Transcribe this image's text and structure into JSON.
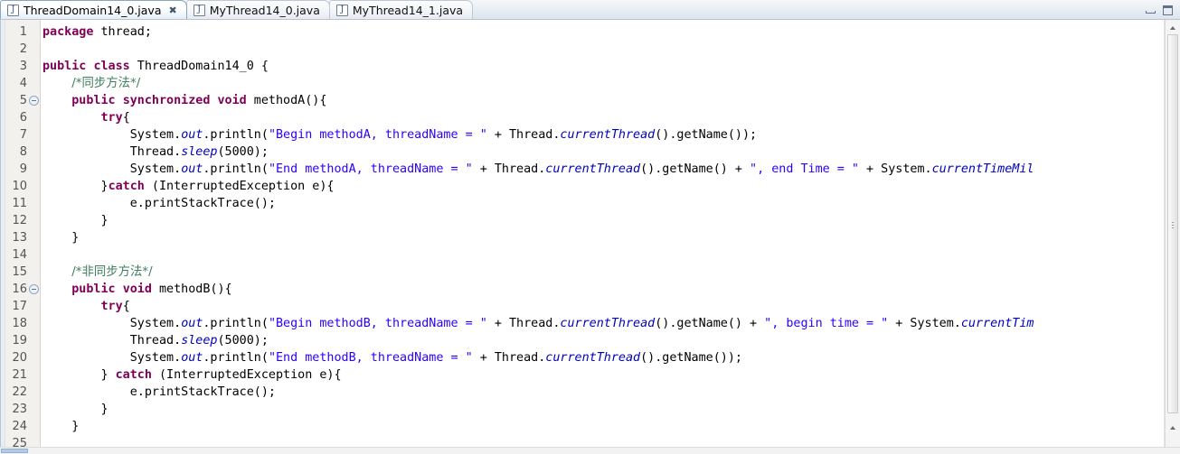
{
  "window": {
    "minimize_label": "Minimize",
    "maximize_label": "Maximize"
  },
  "tabs": [
    {
      "label": "ThreadDomain14_0.java",
      "icon": "java-file-icon",
      "icon_glyph": "J",
      "active": true,
      "close_glyph": "✖"
    },
    {
      "label": "MyThread14_0.java",
      "icon": "java-file-icon",
      "icon_glyph": "J",
      "active": false,
      "close_glyph": ""
    },
    {
      "label": "MyThread14_1.java",
      "icon": "java-file-icon",
      "icon_glyph": "J",
      "active": false,
      "close_glyph": ""
    }
  ],
  "editor": {
    "language": "java",
    "first_visible_line": 1,
    "last_visible_line": 25,
    "fold_marker_lines": [
      5,
      16
    ],
    "fold_glyph": "⊖",
    "line_numbers": [
      1,
      2,
      3,
      4,
      5,
      6,
      7,
      8,
      9,
      10,
      11,
      12,
      13,
      14,
      15,
      16,
      17,
      18,
      19,
      20,
      21,
      22,
      23,
      24,
      25
    ],
    "colors": {
      "keyword": "#7f0055",
      "string": "#2a00ff",
      "comment": "#3f7f5f",
      "field": "#0000c0",
      "background": "#ffffff",
      "gutter_background": "#f3f1ee",
      "text": "#000000"
    },
    "lines": [
      {
        "n": 1,
        "text": "package thread;"
      },
      {
        "n": 2,
        "text": ""
      },
      {
        "n": 3,
        "text": "public class ThreadDomain14_0 {"
      },
      {
        "n": 4,
        "text": "    /*同步方法*/"
      },
      {
        "n": 5,
        "text": "    public synchronized void methodA(){"
      },
      {
        "n": 6,
        "text": "        try{"
      },
      {
        "n": 7,
        "text": "            System.out.println(\"Begin methodA, threadName = \" + Thread.currentThread().getName());"
      },
      {
        "n": 8,
        "text": "            Thread.sleep(5000);"
      },
      {
        "n": 9,
        "text": "            System.out.println(\"End methodA, threadName = \" + Thread.currentThread().getName() + \", end Time = \" + System.currentTimeMil"
      },
      {
        "n": 10,
        "text": "        }catch (InterruptedException e){"
      },
      {
        "n": 11,
        "text": "            e.printStackTrace();"
      },
      {
        "n": 12,
        "text": "        }"
      },
      {
        "n": 13,
        "text": "    }"
      },
      {
        "n": 14,
        "text": ""
      },
      {
        "n": 15,
        "text": "    /*非同步方法*/"
      },
      {
        "n": 16,
        "text": "    public void methodB(){"
      },
      {
        "n": 17,
        "text": "        try{"
      },
      {
        "n": 18,
        "text": "            System.out.println(\"Begin methodB, threadName = \" + Thread.currentThread().getName() + \", begin time = \" + System.currentTim"
      },
      {
        "n": 19,
        "text": "            Thread.sleep(5000);"
      },
      {
        "n": 20,
        "text": "            System.out.println(\"End methodB, threadName = \" + Thread.currentThread().getName());"
      },
      {
        "n": 21,
        "text": "        } catch (InterruptedException e){"
      },
      {
        "n": 22,
        "text": "            e.printStackTrace();"
      },
      {
        "n": 23,
        "text": "        }"
      },
      {
        "n": 24,
        "text": "    }"
      },
      {
        "n": 25,
        "text": ""
      }
    ]
  },
  "scrollbars": {
    "vertical": {
      "up_arrow_glyph": "▲",
      "down_arrow_glyph": "▼",
      "thumb_position_pct": 3,
      "thumb_size_pct": 88
    },
    "horizontal": {
      "thumb_position_pct": 0,
      "thumb_size_pct": 2
    }
  }
}
